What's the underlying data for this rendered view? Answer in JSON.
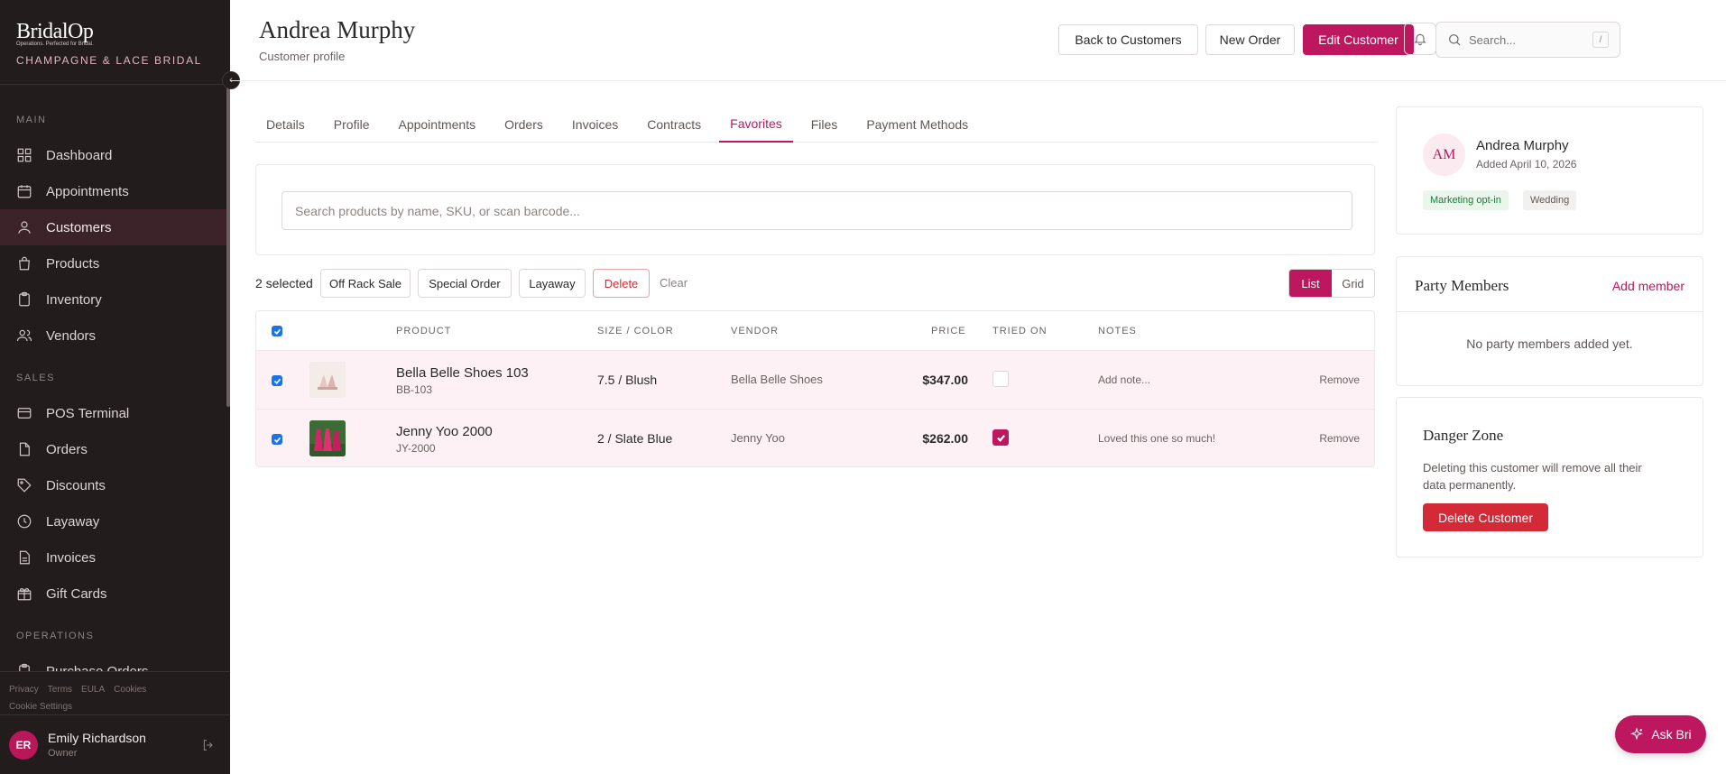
{
  "brand": {
    "logo": "BridalOp",
    "tagline": "Operations. Perfected for Bridal.",
    "store": "CHAMPAGNE & LACE BRIDAL"
  },
  "sidebar": {
    "sections": [
      {
        "title": "MAIN",
        "items": [
          {
            "label": "Dashboard",
            "icon": "dashboard-icon"
          },
          {
            "label": "Appointments",
            "icon": "calendar-icon"
          },
          {
            "label": "Customers",
            "icon": "user-icon",
            "active": true
          },
          {
            "label": "Products",
            "icon": "bag-icon"
          },
          {
            "label": "Inventory",
            "icon": "clipboard-icon"
          },
          {
            "label": "Vendors",
            "icon": "users-icon"
          }
        ]
      },
      {
        "title": "SALES",
        "items": [
          {
            "label": "POS Terminal",
            "icon": "terminal-icon"
          },
          {
            "label": "Orders",
            "icon": "document-icon"
          },
          {
            "label": "Discounts",
            "icon": "tag-icon"
          },
          {
            "label": "Layaway",
            "icon": "clock-icon"
          },
          {
            "label": "Invoices",
            "icon": "file-icon"
          },
          {
            "label": "Gift Cards",
            "icon": "gift-icon"
          }
        ]
      },
      {
        "title": "OPERATIONS",
        "items": [
          {
            "label": "Purchase Orders",
            "icon": "clipboard-icon"
          }
        ]
      }
    ],
    "legal": [
      "Privacy",
      "Terms",
      "EULA",
      "Cookies",
      "Cookie Settings"
    ],
    "user": {
      "initials": "ER",
      "name": "Emily Richardson",
      "role": "Owner"
    }
  },
  "header": {
    "title": "Andrea Murphy",
    "subtitle": "Customer profile",
    "buttons": {
      "back": "Back to Customers",
      "new_order": "New Order",
      "edit": "Edit Customer"
    },
    "search": {
      "placeholder": "Search...",
      "shortcut": "/"
    }
  },
  "tabs": [
    "Details",
    "Profile",
    "Appointments",
    "Orders",
    "Invoices",
    "Contracts",
    "Favorites",
    "Files",
    "Payment Methods"
  ],
  "active_tab": "Favorites",
  "product_search": {
    "placeholder": "Search products by name, SKU, or scan barcode..."
  },
  "toolbar": {
    "selected": "2 selected",
    "off_rack": "Off Rack Sale",
    "special_order": "Special Order",
    "layaway": "Layaway",
    "delete": "Delete",
    "clear": "Clear",
    "view_list": "List",
    "view_grid": "Grid"
  },
  "table": {
    "headers": {
      "product": "PRODUCT",
      "size_color": "SIZE / COLOR",
      "vendor": "VENDOR",
      "price": "PRICE",
      "tried_on": "TRIED ON",
      "notes": "NOTES"
    },
    "rows": [
      {
        "name": "Bella Belle Shoes 103",
        "sku": "BB-103",
        "size_color": "7.5 / Blush",
        "vendor": "Bella Belle Shoes",
        "price": "$347.00",
        "tried_on": false,
        "note": "Add note...",
        "remove": "Remove"
      },
      {
        "name": "Jenny Yoo 2000",
        "sku": "JY-2000",
        "size_color": "2 / Slate Blue",
        "vendor": "Jenny Yoo",
        "price": "$262.00",
        "tried_on": true,
        "note": "Loved this one so much!",
        "remove": "Remove"
      }
    ]
  },
  "customer_card": {
    "initials": "AM",
    "name": "Andrea Murphy",
    "added": "Added April 10, 2026",
    "tags": [
      "Marketing opt-in",
      "Wedding"
    ]
  },
  "party": {
    "title": "Party Members",
    "add": "Add member",
    "empty": "No party members added yet."
  },
  "danger": {
    "title": "Danger Zone",
    "text": "Deleting this customer will remove all their data permanently.",
    "button": "Delete Customer"
  },
  "ask_bri": "Ask Bri",
  "colors": {
    "accent": "#bd1760",
    "sidebar_bg": "#231c1c",
    "danger": "#d42a38"
  }
}
